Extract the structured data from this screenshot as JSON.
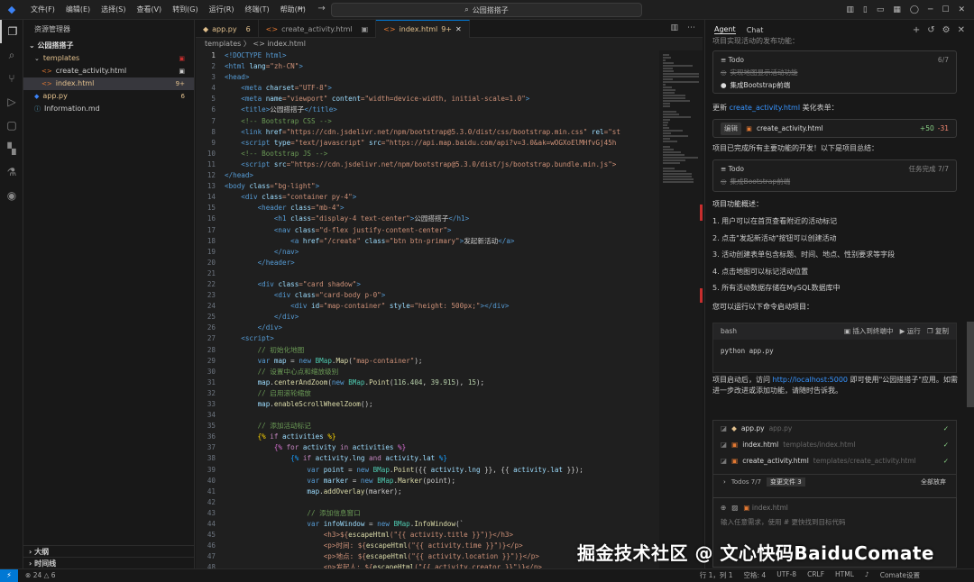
{
  "titlebar": {
    "menu": [
      "文件(F)",
      "编辑(E)",
      "选择(S)",
      "查看(V)",
      "转到(G)",
      "运行(R)",
      "终端(T)",
      "帮助(H)"
    ],
    "search": "公园搭搭子"
  },
  "sidebar": {
    "title": "资源管理器",
    "root": "公园搭搭子",
    "items": [
      {
        "label": "templates",
        "indent": 1,
        "kind": "folder",
        "color": "#e2c08d",
        "badge": ""
      },
      {
        "label": "create_activity.html",
        "indent": 2,
        "kind": "html",
        "color": "#ccc",
        "badge": ""
      },
      {
        "label": "index.html",
        "indent": 2,
        "kind": "html",
        "color": "#e2c08d",
        "badge": "9+"
      },
      {
        "label": "app.py",
        "indent": 1,
        "kind": "py",
        "color": "#e2c08d",
        "badge": "6"
      },
      {
        "label": "Information.md",
        "indent": 1,
        "kind": "md",
        "color": "#ccc",
        "badge": ""
      }
    ],
    "outline": "大纲",
    "timeline": "时间线"
  },
  "tabs": [
    {
      "label": "app.py",
      "badge": "6"
    },
    {
      "label": "create_activity.html",
      "badge": ""
    },
    {
      "label": "index.html",
      "badge": "9+"
    }
  ],
  "breadcrumb": "templates 〉 <> index.html",
  "code": [
    [
      [
        "<!DOCTYPE html>",
        "#569cd6"
      ]
    ],
    [
      [
        "<html ",
        "#569cd6"
      ],
      [
        "lang",
        "#9cdcfe"
      ],
      [
        "=\"zh-CN\"",
        "#ce9178"
      ],
      [
        ">",
        "#569cd6"
      ]
    ],
    [
      [
        "<head>",
        "#569cd6"
      ]
    ],
    [
      [
        "    <meta ",
        "#569cd6"
      ],
      [
        "charset",
        "#9cdcfe"
      ],
      [
        "=\"UTF-8\"",
        "#ce9178"
      ],
      [
        ">",
        "#569cd6"
      ]
    ],
    [
      [
        "    <meta ",
        "#569cd6"
      ],
      [
        "name",
        "#9cdcfe"
      ],
      [
        "=\"viewport\" ",
        "#ce9178"
      ],
      [
        "content",
        "#9cdcfe"
      ],
      [
        "=\"width=device-width, initial-scale=1.0\"",
        "#ce9178"
      ],
      [
        ">",
        "#569cd6"
      ]
    ],
    [
      [
        "    <title>",
        "#569cd6"
      ],
      [
        "公园搭搭子",
        "#ccc"
      ],
      [
        "</title>",
        "#569cd6"
      ]
    ],
    [
      [
        "    <!-- Bootstrap CSS -->",
        "#6a9955"
      ]
    ],
    [
      [
        "    <link ",
        "#569cd6"
      ],
      [
        "href",
        "#9cdcfe"
      ],
      [
        "=\"https://cdn.jsdelivr.net/npm/bootstrap@5.3.0/dist/css/bootstrap.min.css\" ",
        "#ce9178"
      ],
      [
        "rel",
        "#9cdcfe"
      ],
      [
        "=\"st",
        "#ce9178"
      ]
    ],
    [
      [
        "    <script ",
        "#569cd6"
      ],
      [
        "type",
        "#9cdcfe"
      ],
      [
        "=\"text/javascript\" ",
        "#ce9178"
      ],
      [
        "src",
        "#9cdcfe"
      ],
      [
        "=\"https://api.map.baidu.com/api?v=3.0&ak=wOGXoElMHfvGj45h",
        "#ce9178"
      ]
    ],
    [
      [
        "    <!-- Bootstrap JS -->",
        "#6a9955"
      ]
    ],
    [
      [
        "    <script ",
        "#569cd6"
      ],
      [
        "src",
        "#9cdcfe"
      ],
      [
        "=\"https://cdn.jsdelivr.net/npm/bootstrap@5.3.0/dist/js/bootstrap.bundle.min.js\">",
        "#ce9178"
      ]
    ],
    [
      [
        "</head>",
        "#569cd6"
      ]
    ],
    [
      [
        "<body ",
        "#569cd6"
      ],
      [
        "class",
        "#9cdcfe"
      ],
      [
        "=\"bg-light\"",
        "#ce9178"
      ],
      [
        ">",
        "#569cd6"
      ]
    ],
    [
      [
        "    <div ",
        "#569cd6"
      ],
      [
        "class",
        "#9cdcfe"
      ],
      [
        "=\"container py-4\"",
        "#ce9178"
      ],
      [
        ">",
        "#569cd6"
      ]
    ],
    [
      [
        "        <header ",
        "#569cd6"
      ],
      [
        "class",
        "#9cdcfe"
      ],
      [
        "=\"mb-4\"",
        "#ce9178"
      ],
      [
        ">",
        "#569cd6"
      ]
    ],
    [
      [
        "            <h1 ",
        "#569cd6"
      ],
      [
        "class",
        "#9cdcfe"
      ],
      [
        "=\"display-4 text-center\"",
        "#ce9178"
      ],
      [
        ">",
        "#569cd6"
      ],
      [
        "公园搭搭子",
        "#ccc"
      ],
      [
        "</h1>",
        "#569cd6"
      ]
    ],
    [
      [
        "            <nav ",
        "#569cd6"
      ],
      [
        "class",
        "#9cdcfe"
      ],
      [
        "=\"d-flex justify-content-center\"",
        "#ce9178"
      ],
      [
        ">",
        "#569cd6"
      ]
    ],
    [
      [
        "                <a ",
        "#569cd6"
      ],
      [
        "href",
        "#9cdcfe"
      ],
      [
        "=\"/create\" ",
        "#ce9178"
      ],
      [
        "class",
        "#9cdcfe"
      ],
      [
        "=\"btn btn-primary\"",
        "#ce9178"
      ],
      [
        ">",
        "#569cd6"
      ],
      [
        "发起新活动",
        "#ccc"
      ],
      [
        "</a>",
        "#569cd6"
      ]
    ],
    [
      [
        "            </nav>",
        "#569cd6"
      ]
    ],
    [
      [
        "        </header>",
        "#569cd6"
      ]
    ],
    [
      [
        "",
        ""
      ]
    ],
    [
      [
        "        <div ",
        "#569cd6"
      ],
      [
        "class",
        "#9cdcfe"
      ],
      [
        "=\"card shadow\"",
        "#ce9178"
      ],
      [
        ">",
        "#569cd6"
      ]
    ],
    [
      [
        "            <div ",
        "#569cd6"
      ],
      [
        "class",
        "#9cdcfe"
      ],
      [
        "=\"card-body p-0\"",
        "#ce9178"
      ],
      [
        ">",
        "#569cd6"
      ]
    ],
    [
      [
        "                <div ",
        "#569cd6"
      ],
      [
        "id",
        "#9cdcfe"
      ],
      [
        "=\"map-container\" ",
        "#ce9178"
      ],
      [
        "style",
        "#9cdcfe"
      ],
      [
        "=\"height: 500px;\"",
        "#ce9178"
      ],
      [
        "></div>",
        "#569cd6"
      ]
    ],
    [
      [
        "            </div>",
        "#569cd6"
      ]
    ],
    [
      [
        "        </div>",
        "#569cd6"
      ]
    ],
    [
      [
        "    <script>",
        "#569cd6"
      ]
    ],
    [
      [
        "        // 初始化地图",
        "#6a9955"
      ]
    ],
    [
      [
        "        var ",
        "#569cd6"
      ],
      [
        "map",
        "#9cdcfe"
      ],
      [
        " = ",
        "#ccc"
      ],
      [
        "new ",
        "#569cd6"
      ],
      [
        "BMap",
        "#4ec9b0"
      ],
      [
        ".",
        "#ccc"
      ],
      [
        "Map",
        "#dcdcaa"
      ],
      [
        "(",
        "#ccc"
      ],
      [
        "\"map-container\"",
        "#ce9178"
      ],
      [
        ");",
        "#ccc"
      ]
    ],
    [
      [
        "        // 设置中心点和缩放级别",
        "#6a9955"
      ]
    ],
    [
      [
        "        map",
        "#9cdcfe"
      ],
      [
        ".",
        "#ccc"
      ],
      [
        "centerAndZoom",
        "#dcdcaa"
      ],
      [
        "(",
        "#ccc"
      ],
      [
        "new ",
        "#569cd6"
      ],
      [
        "BMap",
        "#4ec9b0"
      ],
      [
        ".",
        "#ccc"
      ],
      [
        "Point",
        "#dcdcaa"
      ],
      [
        "(",
        "#ccc"
      ],
      [
        "116.404",
        "#b5cea8"
      ],
      [
        ", ",
        "#ccc"
      ],
      [
        "39.915",
        "#b5cea8"
      ],
      [
        "), ",
        "#ccc"
      ],
      [
        "15",
        "#b5cea8"
      ],
      [
        ");",
        "#ccc"
      ]
    ],
    [
      [
        "        // 启用滚轮缩放",
        "#6a9955"
      ]
    ],
    [
      [
        "        map",
        "#9cdcfe"
      ],
      [
        ".",
        "#ccc"
      ],
      [
        "enableScrollWheelZoom",
        "#dcdcaa"
      ],
      [
        "();",
        "#ccc"
      ]
    ],
    [
      [
        "",
        ""
      ]
    ],
    [
      [
        "        // 添加活动标记",
        "#6a9955"
      ]
    ],
    [
      [
        "        {% ",
        "#ffd700"
      ],
      [
        "if ",
        "#c586c0"
      ],
      [
        "activities ",
        "#9cdcfe"
      ],
      [
        "%}",
        "#ffd700"
      ]
    ],
    [
      [
        "            {% ",
        "#da70d6"
      ],
      [
        "for ",
        "#c586c0"
      ],
      [
        "activity ",
        "#9cdcfe"
      ],
      [
        "in ",
        "#c586c0"
      ],
      [
        "activities ",
        "#9cdcfe"
      ],
      [
        "%}",
        "#da70d6"
      ]
    ],
    [
      [
        "                {% ",
        "#179fff"
      ],
      [
        "if ",
        "#c586c0"
      ],
      [
        "activity",
        "#9cdcfe"
      ],
      [
        ".",
        "#ccc"
      ],
      [
        "lng ",
        "#9cdcfe"
      ],
      [
        "and ",
        "#c586c0"
      ],
      [
        "activity",
        "#9cdcfe"
      ],
      [
        ".",
        "#ccc"
      ],
      [
        "lat ",
        "#9cdcfe"
      ],
      [
        "%}",
        "#179fff"
      ]
    ],
    [
      [
        "                    var ",
        "#569cd6"
      ],
      [
        "point",
        "#9cdcfe"
      ],
      [
        " = ",
        "#ccc"
      ],
      [
        "new ",
        "#569cd6"
      ],
      [
        "BMap",
        "#4ec9b0"
      ],
      [
        ".",
        "#ccc"
      ],
      [
        "Point",
        "#dcdcaa"
      ],
      [
        "({{ ",
        "#ccc"
      ],
      [
        "activity",
        "#9cdcfe"
      ],
      [
        ".",
        "#ccc"
      ],
      [
        "lng ",
        "#9cdcfe"
      ],
      [
        "}}, {{ ",
        "#ccc"
      ],
      [
        "activity",
        "#9cdcfe"
      ],
      [
        ".",
        "#ccc"
      ],
      [
        "lat ",
        "#9cdcfe"
      ],
      [
        "}});",
        "#ccc"
      ]
    ],
    [
      [
        "                    var ",
        "#569cd6"
      ],
      [
        "marker",
        "#9cdcfe"
      ],
      [
        " = ",
        "#ccc"
      ],
      [
        "new ",
        "#569cd6"
      ],
      [
        "BMap",
        "#4ec9b0"
      ],
      [
        ".",
        "#ccc"
      ],
      [
        "Marker",
        "#dcdcaa"
      ],
      [
        "(point);",
        "#ccc"
      ]
    ],
    [
      [
        "                    map",
        "#9cdcfe"
      ],
      [
        ".",
        "#ccc"
      ],
      [
        "addOverlay",
        "#dcdcaa"
      ],
      [
        "(marker);",
        "#ccc"
      ]
    ],
    [
      [
        "",
        ""
      ]
    ],
    [
      [
        "                    // 添加信息窗口",
        "#6a9955"
      ]
    ],
    [
      [
        "                    var ",
        "#569cd6"
      ],
      [
        "infoWindow",
        "#9cdcfe"
      ],
      [
        " = ",
        "#ccc"
      ],
      [
        "new ",
        "#569cd6"
      ],
      [
        "BMap",
        "#4ec9b0"
      ],
      [
        ".",
        "#ccc"
      ],
      [
        "InfoWindow",
        "#dcdcaa"
      ],
      [
        "(`",
        "#ccc"
      ]
    ],
    [
      [
        "                        <h3>${",
        "#ce9178"
      ],
      [
        "escapeHtml",
        "#dcdcaa"
      ],
      [
        "(\"{{ activity.title }}\")",
        "#ce9178"
      ],
      [
        "}</h3>",
        "#ce9178"
      ]
    ],
    [
      [
        "                        <p>时间: ${",
        "#ce9178"
      ],
      [
        "escapeHtml",
        "#dcdcaa"
      ],
      [
        "(\"{{ activity.time }}\")",
        "#ce9178"
      ],
      [
        "}</p>",
        "#ce9178"
      ]
    ],
    [
      [
        "                        <p>地点: ${",
        "#ce9178"
      ],
      [
        "escapeHtml",
        "#dcdcaa"
      ],
      [
        "(\"{{ activity.location }}\")",
        "#ce9178"
      ],
      [
        "}</p>",
        "#ce9178"
      ]
    ],
    [
      [
        "                        <p>发起人: ${",
        "#ce9178"
      ],
      [
        "escapeHtml",
        "#dcdcaa"
      ],
      [
        "(\"{{ activity.creator }}\")",
        "#ce9178"
      ],
      [
        "}</p>",
        "#ce9178"
      ]
    ]
  ],
  "chat": {
    "tabs": [
      "Agent",
      "Chat"
    ],
    "cut_line": "项目实现活动的发布功能：",
    "todo1": {
      "label": "Todo",
      "count": "6/7",
      "done": "实现地图显示活动功能",
      "current": "集成Bootstrap前端"
    },
    "update_text": "更新",
    "update_link": "create_activity.html",
    "update_suffix": "美化表单：",
    "edit": {
      "tag": "编辑",
      "file": "create_activity.html",
      "plus": "+50",
      "minus": "-31"
    },
    "summary_intro": "项目已完成所有主要功能的开发！以下是项目总结：",
    "todo2": {
      "label": "Todo",
      "status": "任务完成 7/7",
      "done": "集成Bootstrap前端"
    },
    "overview_title": "项目功能概述：",
    "features": [
      "1. 用户可以在首页查看附近的活动标记",
      "2. 点击\"发起新活动\"按钮可以创建活动",
      "3. 活动创建表单包含标题、时间、地点、性别要求等字段",
      "4. 点击地图可以标记活动位置",
      "5. 所有活动数据存储在MySQL数据库中"
    ],
    "run_hint": "您可以运行以下命令启动项目：",
    "codeblock": {
      "lang": "bash",
      "insert": "插入到终端中",
      "run": "运行",
      "copy": "复制",
      "cmd": "python app.py"
    },
    "after_1": "项目启动后，访问 ",
    "after_link": "http://localhost:5000",
    "after_2": " 即可使用\"公园搭搭子\"应用。如需",
    "after_3": "进一步改进或添加功能，请随时告诉我。",
    "files": [
      {
        "name": "app.py",
        "path": "app.py"
      },
      {
        "name": "index.html",
        "path": "templates/index.html"
      },
      {
        "name": "create_activity.html",
        "path": "templates/create_activity.html"
      }
    ],
    "todos_label": "Todos 7/7",
    "changes_label": "变更文件 3",
    "reject_all": "全部放弃",
    "input_file": "index.html",
    "input_placeholder": "输入任意需求，使用 # 更快找到目标代码"
  },
  "status": {
    "errors": "24",
    "warnings": "6",
    "pos": "行 1，列 1",
    "spaces": "空格: 4",
    "enc": "UTF-8",
    "eol": "CRLF",
    "lang": "HTML",
    "ext": "Comate设置"
  },
  "watermark": "掘金技术社区 @ 文心快码BaiduComate"
}
